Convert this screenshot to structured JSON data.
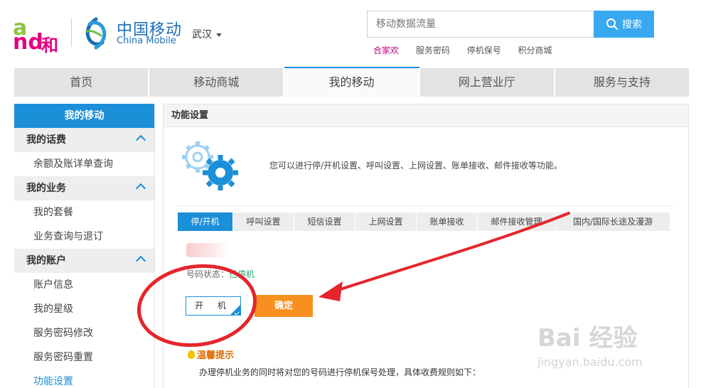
{
  "header": {
    "logo_and_text": "and",
    "logo_he_text": "和",
    "logo_cn": "中国移动",
    "logo_en": "China Mobile",
    "city": "武汉",
    "search_placeholder": "移动数据流量",
    "search_button": "搜索",
    "quick_links": [
      "合家欢",
      "服务密码",
      "停机保号",
      "积分商城"
    ]
  },
  "nav": {
    "items": [
      "首页",
      "移动商城",
      "我的移动",
      "网上营业厅",
      "服务与支持"
    ],
    "active": "我的移动"
  },
  "sidebar": {
    "title": "我的移动",
    "groups": [
      {
        "label": "我的话费",
        "items": [
          "余额及账详单查询"
        ]
      },
      {
        "label": "我的业务",
        "items": [
          "我的套餐",
          "业务查询与退订"
        ]
      },
      {
        "label": "我的账户",
        "items": [
          "账户信息",
          "我的星级",
          "服务密码修改",
          "服务密码重置",
          "功能设置"
        ]
      }
    ],
    "active_item": "功能设置"
  },
  "content": {
    "title": "功能设置",
    "intro": "您可以进行停/开机设置、呼叫设置、上网设置、账单接收、邮件接收等功能。",
    "tabs": [
      "停/开机",
      "呼叫设置",
      "短信设置",
      "上网设置",
      "账单接收",
      "邮件接收管理",
      "国内/国际长途及漫游"
    ],
    "active_tab": "停/开机",
    "status_label": "号码状态：",
    "status_value": "已停机",
    "power_select_value": "开 机",
    "confirm_button": "确定",
    "tip_title": "温馨提示",
    "tip_text": "办理停机业务的同时将对您的号码进行停机保号处理，具体收费规则如下："
  },
  "watermark": {
    "main": "Bai 经验",
    "sub": "jingyan.baidu.com"
  },
  "colors": {
    "brand_blue": "#1b8fd8",
    "search_blue": "#38a8f0",
    "confirm_orange": "#f7901e",
    "annotation_red": "#e5252b",
    "and_green": "#8cc63f",
    "and_magenta": "#e4007f"
  }
}
